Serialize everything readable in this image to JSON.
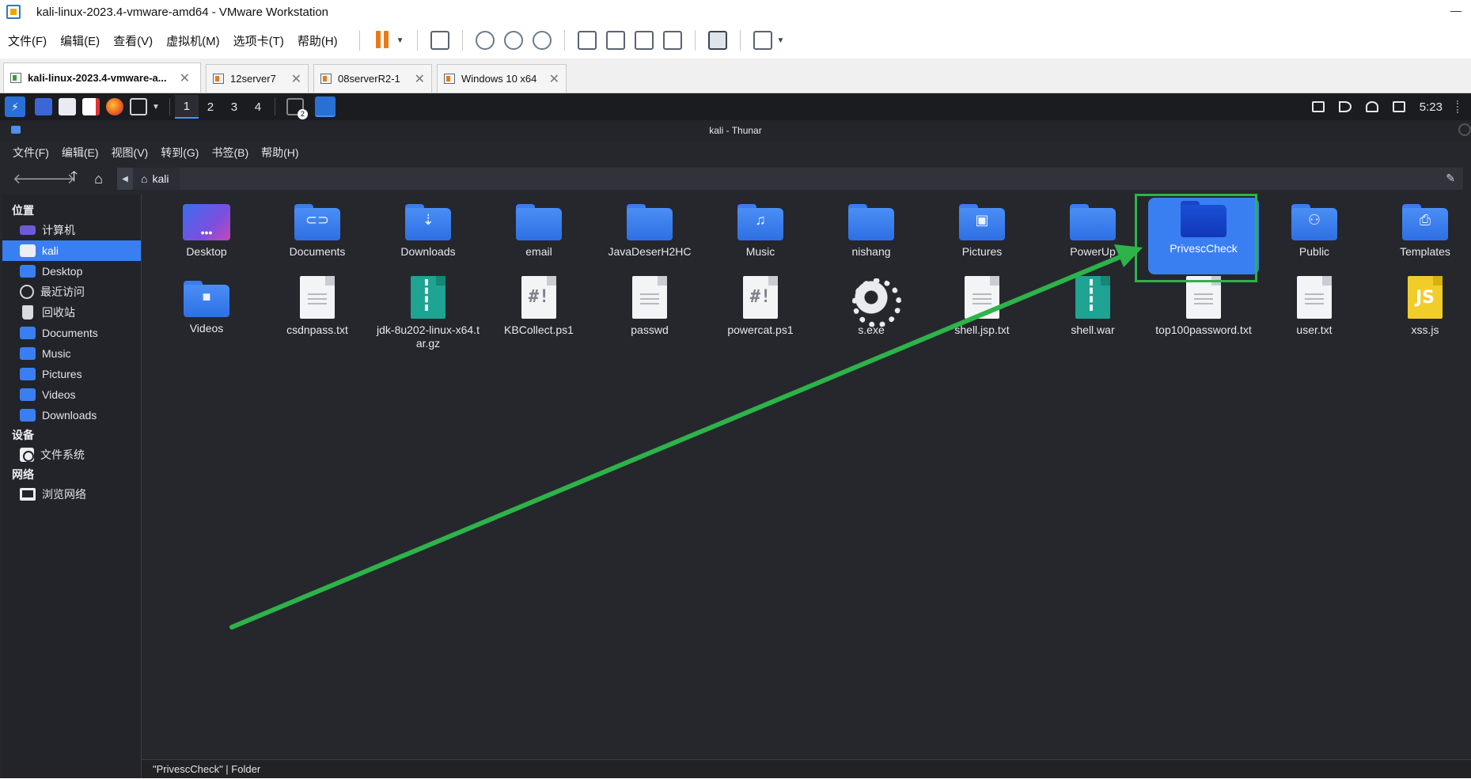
{
  "vmware": {
    "title": "kali-linux-2023.4-vmware-amd64 - VMware Workstation",
    "menu": [
      "文件(F)",
      "编辑(E)",
      "查看(V)",
      "虚拟机(M)",
      "选项卡(T)",
      "帮助(H)"
    ],
    "tabs": [
      {
        "label": "kali-linux-2023.4-vmware-a...",
        "active": true
      },
      {
        "label": "12server7",
        "active": false
      },
      {
        "label": "08serverR2-1",
        "active": false
      },
      {
        "label": "Windows 10 x64",
        "active": false
      }
    ],
    "accent": "#e8791a"
  },
  "panel": {
    "workspaces": [
      "1",
      "2",
      "3",
      "4"
    ],
    "task_badge": "2",
    "clock": "5:23"
  },
  "thunar": {
    "title": "kali - Thunar",
    "menu": [
      "文件(F)",
      "编辑(E)",
      "视图(V)",
      "转到(G)",
      "书签(B)",
      "帮助(H)"
    ],
    "path": "kali",
    "sidebar": {
      "places_heading": "位置",
      "places": [
        {
          "label": "计算机",
          "icon": "computer-icon"
        },
        {
          "label": "kali",
          "icon": "home-icon",
          "selected": true
        },
        {
          "label": "Desktop",
          "icon": "desktop-folder-icon"
        },
        {
          "label": "最近访问",
          "icon": "recent-icon"
        },
        {
          "label": "回收站",
          "icon": "trash-icon"
        },
        {
          "label": "Documents",
          "icon": "documents-folder-icon"
        },
        {
          "label": "Music",
          "icon": "music-folder-icon"
        },
        {
          "label": "Pictures",
          "icon": "pictures-folder-icon"
        },
        {
          "label": "Videos",
          "icon": "videos-folder-icon"
        },
        {
          "label": "Downloads",
          "icon": "downloads-folder-icon"
        }
      ],
      "devices_heading": "设备",
      "devices": [
        {
          "label": "文件系统",
          "icon": "filesystem-icon"
        }
      ],
      "network_heading": "网络",
      "network": [
        {
          "label": "浏览网络",
          "icon": "network-icon"
        }
      ]
    },
    "files": [
      {
        "name": "Desktop",
        "kind": "desktop"
      },
      {
        "name": "Documents",
        "kind": "folder",
        "glyph": "⊂⊃"
      },
      {
        "name": "Downloads",
        "kind": "folder",
        "glyph": "⇣"
      },
      {
        "name": "email",
        "kind": "folder",
        "glyph": ""
      },
      {
        "name": "JavaDeserH2HC",
        "kind": "folder",
        "glyph": ""
      },
      {
        "name": "Music",
        "kind": "folder",
        "glyph": "♫"
      },
      {
        "name": "nishang",
        "kind": "folder",
        "glyph": ""
      },
      {
        "name": "Pictures",
        "kind": "folder",
        "glyph": "▣"
      },
      {
        "name": "PowerUp",
        "kind": "folder",
        "glyph": ""
      },
      {
        "name": "PrivescCheck",
        "kind": "folder",
        "glyph": "",
        "selected": true
      },
      {
        "name": "Public",
        "kind": "folder",
        "glyph": "⚇"
      },
      {
        "name": "Templates",
        "kind": "folder",
        "glyph": "⎙"
      },
      {
        "name": "Videos",
        "kind": "folder",
        "glyph": "■"
      },
      {
        "name": "csdnpass.txt",
        "kind": "text"
      },
      {
        "name": "jdk-8u202-linux-x64.tar.gz",
        "kind": "archive"
      },
      {
        "name": "KBCollect.ps1",
        "kind": "script",
        "glyph": "#!"
      },
      {
        "name": "passwd",
        "kind": "text"
      },
      {
        "name": "powercat.ps1",
        "kind": "script",
        "glyph": "#!"
      },
      {
        "name": "s.exe",
        "kind": "exe"
      },
      {
        "name": "shell.jsp.txt",
        "kind": "text"
      },
      {
        "name": "shell.war",
        "kind": "archive"
      },
      {
        "name": "top100password.txt",
        "kind": "text"
      },
      {
        "name": "user.txt",
        "kind": "text"
      },
      {
        "name": "xss.js",
        "kind": "js",
        "glyph": "JS"
      }
    ],
    "status": "\"PrivescCheck\" | Folder"
  },
  "annotation": {
    "color": "#2db34a"
  }
}
